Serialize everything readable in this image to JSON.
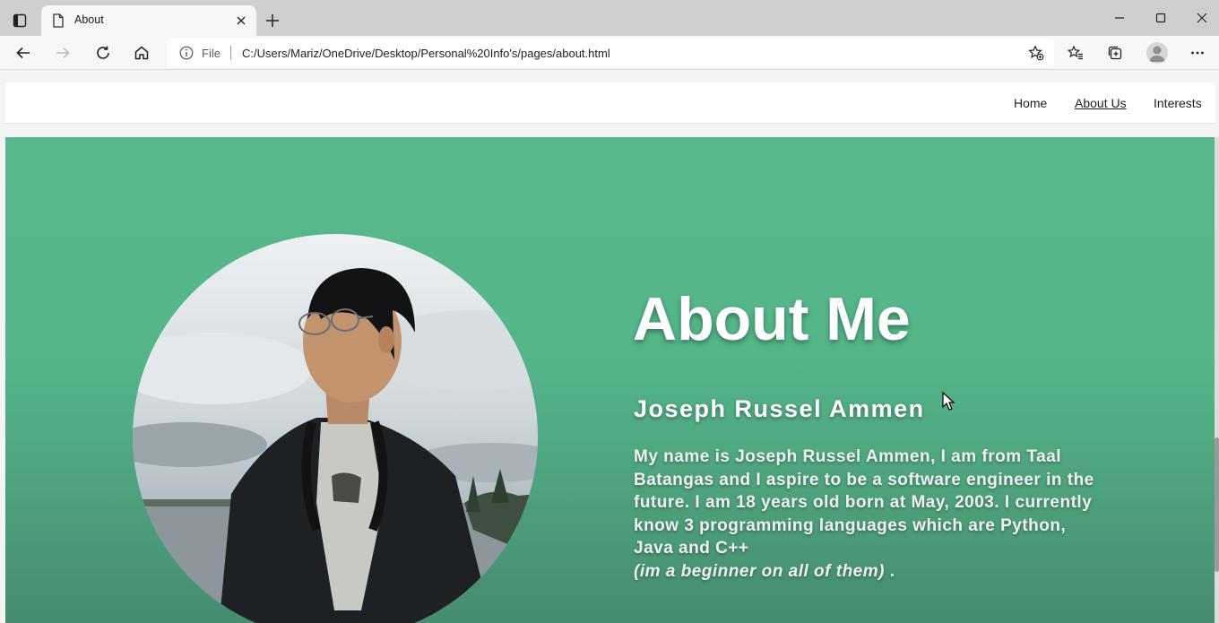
{
  "browser": {
    "tab": {
      "title": "About",
      "icon": "page-icon"
    },
    "address": {
      "scheme_label": "File",
      "url": "C:/Users/Mariz/OneDrive/Desktop/Personal%20Info's/pages/about.html"
    }
  },
  "nav": {
    "home": "Home",
    "about": "About Us",
    "interests": "Interests"
  },
  "about": {
    "title": "About Me",
    "name": "Joseph Russel Ammen",
    "bio": "My name is Joseph Russel Ammen, I am from Taal Batangas and I aspire to be a software engineer in the future. I am 18 years old born at May, 2003. I currently know 3 programming languages which are Python, Java and C++",
    "bio_note": "(im a beginner on all of them)",
    "bio_end": " ."
  },
  "colors": {
    "hero_green": "#56b88b",
    "text_white": "#ffffff"
  }
}
